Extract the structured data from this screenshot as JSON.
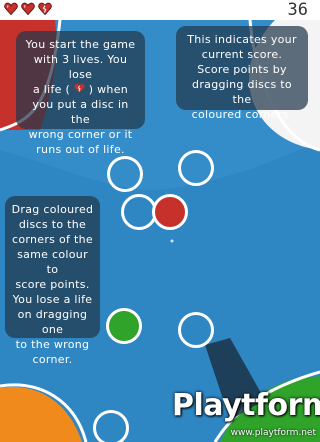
{
  "hud": {
    "score": "36",
    "lives": [
      {
        "state": "full",
        "icon": "heart-icon"
      },
      {
        "state": "full",
        "icon": "heart-icon"
      },
      {
        "state": "broken",
        "icon": "broken-heart-icon"
      }
    ]
  },
  "tutorial": {
    "lives_line1": "You start the game",
    "lives_line2": "with 3 lives. You lose",
    "lives_line3_pre": "a life (",
    "lives_line3_post": ") when",
    "lives_line4": "you put a disc in the",
    "lives_line5": "wrong corner or it",
    "lives_line6": "runs out of life.",
    "score_line1": "This indicates your",
    "score_line2": "current score.",
    "score_line3": "Score points by",
    "score_line4": "dragging discs to the",
    "score_line5": "coloured corners.",
    "drag_line1": "Drag coloured",
    "drag_line2": "discs to the",
    "drag_line3": "corners of the",
    "drag_line4": "same colour to",
    "drag_line5": "score points.",
    "drag_line6": "You lose a life",
    "drag_line7": "on dragging one",
    "drag_line8": "to the wrong",
    "drag_line9": "corner."
  },
  "colors": {
    "water": "#2e86c3",
    "corner_red": "#c7312b",
    "corner_green": "#2fa32a",
    "corner_orange": "#f08a1c",
    "disc_red": "#c7312b",
    "disc_green": "#2fa32a"
  },
  "watermark": {
    "brand": "Playtform",
    "url": "www.playtform.net"
  }
}
